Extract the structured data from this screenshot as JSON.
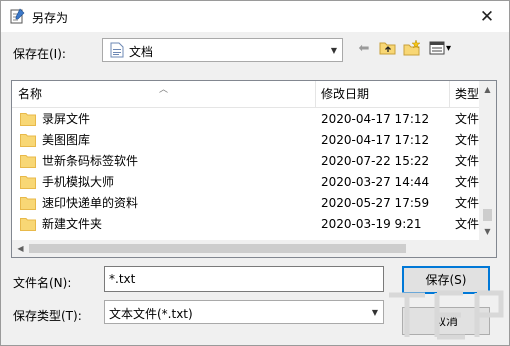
{
  "window": {
    "title": "另存为",
    "close_glyph": "✕"
  },
  "save_in": {
    "label": "保存在(I):",
    "value": "文档"
  },
  "toolbar": {
    "back_glyph": "⬅",
    "view_menu_glyph": "▾",
    "icons": [
      "back-icon",
      "up-folder-icon",
      "new-folder-icon",
      "view-menu-icon"
    ]
  },
  "list": {
    "columns": [
      "名称",
      "修改日期",
      "类型"
    ],
    "rows": [
      {
        "name": "录屏文件",
        "date": "2020-04-17 17:12",
        "type": "文件"
      },
      {
        "name": "美图图库",
        "date": "2020-04-17 17:12",
        "type": "文件"
      },
      {
        "name": "世新条码标签软件",
        "date": "2020-07-22 15:22",
        "type": "文件"
      },
      {
        "name": "手机模拟大师",
        "date": "2020-03-27 14:44",
        "type": "文件"
      },
      {
        "name": "速印快递单的资料",
        "date": "2020-05-27 17:59",
        "type": "文件"
      },
      {
        "name": "新建文件夹",
        "date": "2020-03-19 9:21",
        "type": "文件"
      }
    ]
  },
  "filename": {
    "label": "文件名(N):",
    "value": "*.txt"
  },
  "filetype": {
    "label": "保存类型(T):",
    "value": "文本文件(*.txt)"
  },
  "buttons": {
    "save": "保存(S)",
    "cancel": "取消"
  },
  "colors": {
    "accent": "#0078d7",
    "folder": "#f8d775",
    "folder_dark": "#e8b94a"
  }
}
